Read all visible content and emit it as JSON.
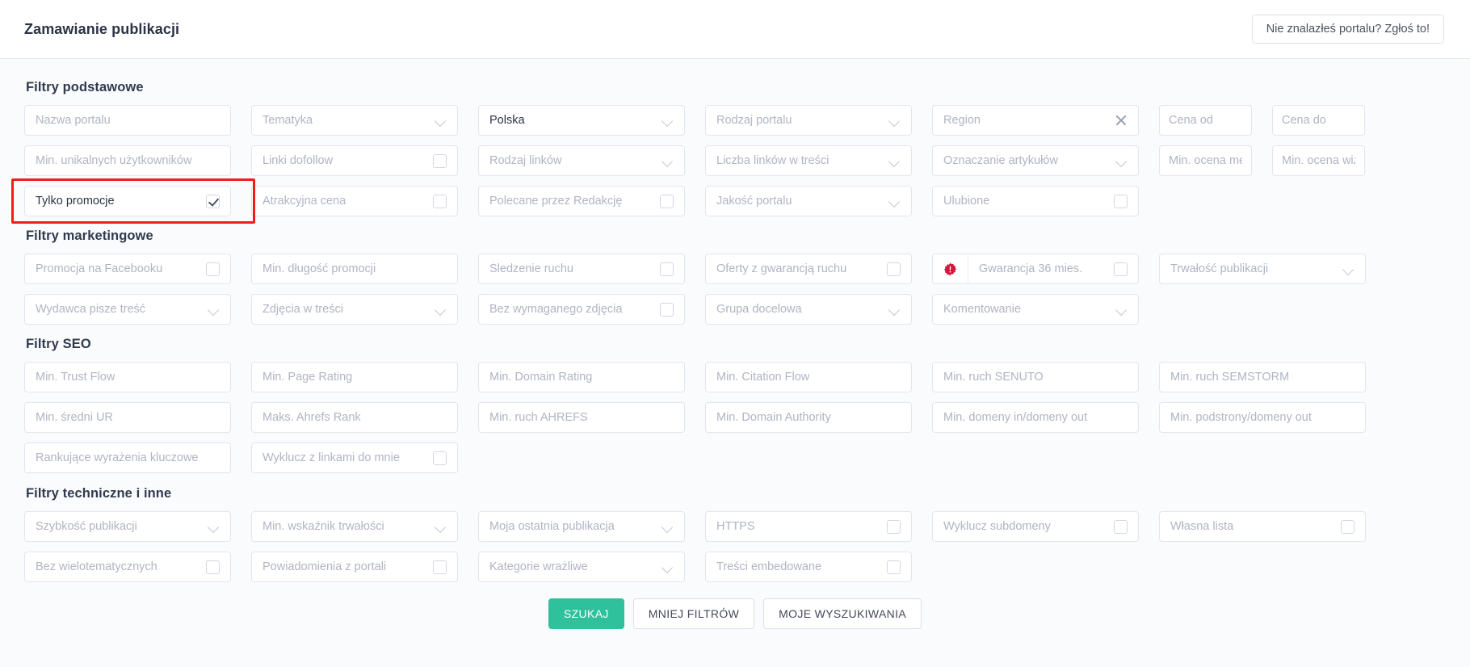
{
  "header": {
    "title": "Zamawianie publikacji",
    "report_button": "Nie znalazłeś portalu? Zgłoś to!"
  },
  "sections": {
    "basic": {
      "title": "Filtry podstawowe",
      "fields": [
        {
          "label": "Nazwa portalu",
          "type": "text"
        },
        {
          "label": "Tematyka",
          "type": "select"
        },
        {
          "label": "Polska",
          "type": "select",
          "filled": true
        },
        {
          "label": "Rodzaj portalu",
          "type": "select"
        },
        {
          "label": "Region",
          "type": "clear"
        },
        {
          "label": "Cena od",
          "type": "text",
          "pair": "Cena do"
        },
        {
          "label": "Min. unikalnych użytkowników",
          "type": "text"
        },
        {
          "label": "Linki dofollow",
          "type": "checkbox"
        },
        {
          "label": "Rodzaj linków",
          "type": "select"
        },
        {
          "label": "Liczba linków w treści",
          "type": "select"
        },
        {
          "label": "Oznaczanie artykułów",
          "type": "select"
        },
        {
          "label": "Min. ocena mer",
          "type": "text",
          "pair": "Min. ocena wizu"
        },
        {
          "label": "Tylko promocje",
          "type": "checkbox",
          "checked": true,
          "filled": true,
          "highlighted": true
        },
        {
          "label": "Atrakcyjna cena",
          "type": "checkbox"
        },
        {
          "label": "Polecane przez Redakcję",
          "type": "checkbox"
        },
        {
          "label": "Jakość portalu",
          "type": "select"
        },
        {
          "label": "Ulubione",
          "type": "checkbox"
        },
        {
          "label": "",
          "type": "empty"
        }
      ]
    },
    "marketing": {
      "title": "Filtry marketingowe",
      "fields": [
        {
          "label": "Promocja na Facebooku",
          "type": "checkbox"
        },
        {
          "label": "Min. długość promocji",
          "type": "text"
        },
        {
          "label": "Śledzenie ruchu",
          "type": "checkbox"
        },
        {
          "label": "Oferty z gwarancją ruchu",
          "type": "checkbox"
        },
        {
          "label": "Gwarancja 36 mies.",
          "type": "checkbox",
          "badge": "red-seal-icon"
        },
        {
          "label": "Trwałość publikacji",
          "type": "select"
        },
        {
          "label": "Wydawca pisze treść",
          "type": "select"
        },
        {
          "label": "Zdjęcia w treści",
          "type": "select"
        },
        {
          "label": "Bez wymaganego zdjęcia",
          "type": "checkbox"
        },
        {
          "label": "Grupa docelowa",
          "type": "select"
        },
        {
          "label": "Komentowanie",
          "type": "select"
        },
        {
          "label": "",
          "type": "empty"
        }
      ]
    },
    "seo": {
      "title": "Filtry SEO",
      "fields": [
        {
          "label": "Min. Trust Flow",
          "type": "text"
        },
        {
          "label": "Min. Page Rating",
          "type": "text"
        },
        {
          "label": "Min. Domain Rating",
          "type": "text"
        },
        {
          "label": "Min. Citation Flow",
          "type": "text"
        },
        {
          "label": "Min. ruch SENUTO",
          "type": "text"
        },
        {
          "label": "Min. ruch SEMSTORM",
          "type": "text"
        },
        {
          "label": "Min. średni UR",
          "type": "text"
        },
        {
          "label": "Maks. Ahrefs Rank",
          "type": "text"
        },
        {
          "label": "Min. ruch AHREFS",
          "type": "text"
        },
        {
          "label": "Min. Domain Authority",
          "type": "text"
        },
        {
          "label": "Min. domeny in/domeny out",
          "type": "text"
        },
        {
          "label": "Min. podstrony/domeny out",
          "type": "text"
        },
        {
          "label": "Rankujące wyrażenia kluczowe",
          "type": "text"
        },
        {
          "label": "Wyklucz z linkami do mnie",
          "type": "checkbox"
        },
        {
          "label": "",
          "type": "empty"
        },
        {
          "label": "",
          "type": "empty"
        },
        {
          "label": "",
          "type": "empty"
        },
        {
          "label": "",
          "type": "empty"
        }
      ]
    },
    "technical": {
      "title": "Filtry techniczne i inne",
      "fields": [
        {
          "label": "Szybkość publikacji",
          "type": "select"
        },
        {
          "label": "Min. wskaźnik trwałości",
          "type": "select"
        },
        {
          "label": "Moja ostatnia publikacja",
          "type": "select"
        },
        {
          "label": "HTTPS",
          "type": "checkbox"
        },
        {
          "label": "Wyklucz subdomeny",
          "type": "checkbox"
        },
        {
          "label": "Własna lista",
          "type": "checkbox"
        },
        {
          "label": "Bez wielotematycznych",
          "type": "checkbox"
        },
        {
          "label": "Powiadomienia z portali",
          "type": "checkbox"
        },
        {
          "label": "Kategorie wrażliwe",
          "type": "select"
        },
        {
          "label": "Treści embedowane",
          "type": "checkbox"
        },
        {
          "label": "",
          "type": "empty"
        },
        {
          "label": "",
          "type": "empty"
        }
      ]
    }
  },
  "footer": {
    "search": "SZUKAJ",
    "less_filters": "MNIEJ FILTRÓW",
    "my_searches": "MOJE WYSZUKIWANIA"
  },
  "colors": {
    "accent_green": "#2ec19b",
    "highlight_red": "#f51b1b",
    "badge_red": "#d6153c",
    "page_bg": "#fafbfc",
    "field_border": "#e3e5ee",
    "placeholder": "#b0b4c4"
  }
}
